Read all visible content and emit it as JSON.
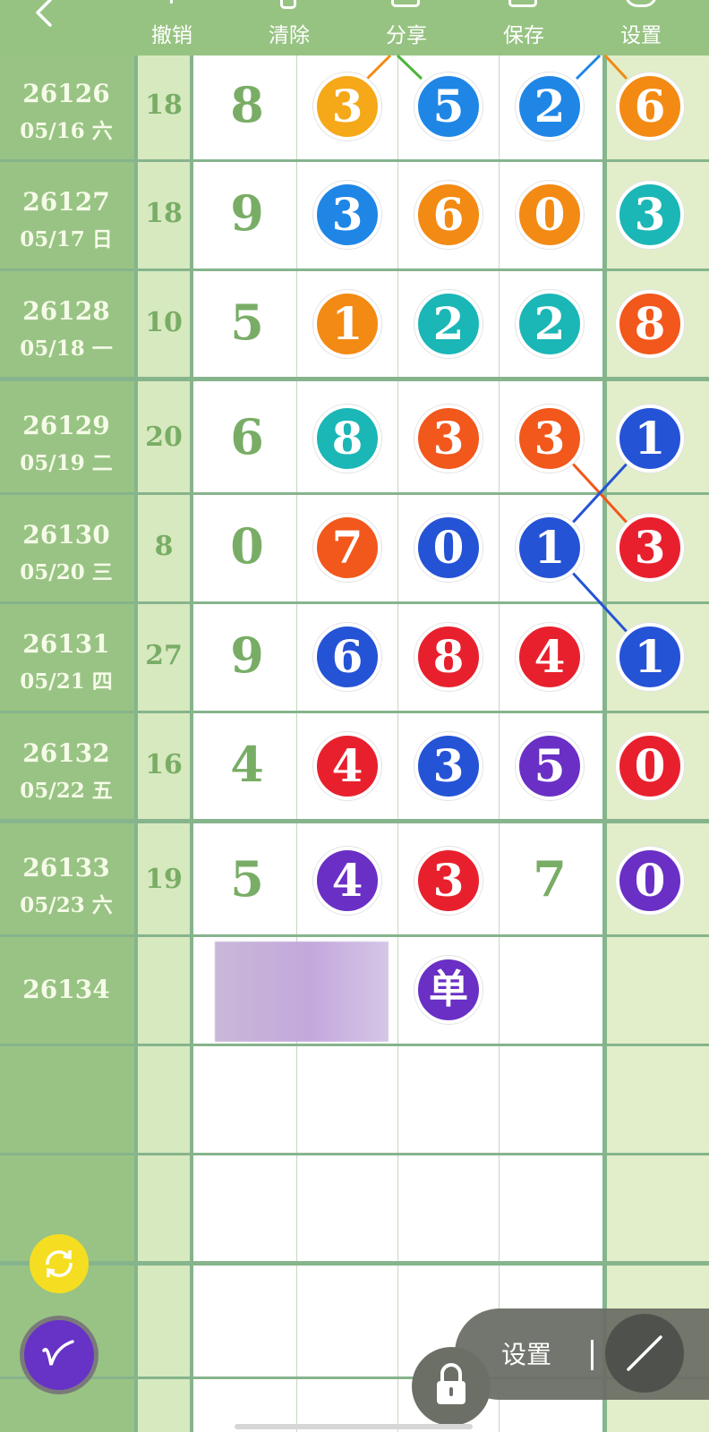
{
  "toolbar": {
    "back_icon": "chevron-left-icon",
    "buttons": [
      {
        "label": "撤销",
        "icon": "undo-icon"
      },
      {
        "label": "清除",
        "icon": "trash-icon"
      },
      {
        "label": "分享",
        "icon": "share-icon"
      },
      {
        "label": "保存",
        "icon": "save-icon"
      },
      {
        "label": "设置",
        "icon": "settings-icon"
      }
    ]
  },
  "rows": [
    {
      "issue": "26126",
      "date": "05/16 六",
      "sum": "18",
      "tail": "8",
      "balls": [
        {
          "n": "3",
          "color": "#f5a818"
        },
        {
          "n": "5",
          "color": "#1f86e6"
        },
        {
          "n": "2",
          "color": "#1f86e6"
        },
        {
          "n": "6",
          "color": "#f38a14"
        }
      ]
    },
    {
      "issue": "26127",
      "date": "05/17 日",
      "sum": "18",
      "tail": "9",
      "balls": [
        {
          "n": "3",
          "color": "#1f86e6"
        },
        {
          "n": "6",
          "color": "#f38a14"
        },
        {
          "n": "0",
          "color": "#f38a14"
        },
        {
          "n": "3",
          "color": "#1bb6b6"
        }
      ]
    },
    {
      "issue": "26128",
      "date": "05/18 一",
      "sum": "10",
      "tail": "5",
      "balls": [
        {
          "n": "1",
          "color": "#f38a14"
        },
        {
          "n": "2",
          "color": "#1bb6b6"
        },
        {
          "n": "2",
          "color": "#1bb6b6"
        },
        {
          "n": "8",
          "color": "#f2571c"
        }
      ]
    },
    {
      "issue": "26129",
      "date": "05/19 二",
      "sum": "20",
      "tail": "6",
      "balls": [
        {
          "n": "8",
          "color": "#1bb6b6"
        },
        {
          "n": "3",
          "color": "#f2571c"
        },
        {
          "n": "3",
          "color": "#f2571c"
        },
        {
          "n": "1",
          "color": "#2553d6"
        }
      ]
    },
    {
      "issue": "26130",
      "date": "05/20 三",
      "sum": "8",
      "tail": "0",
      "balls": [
        {
          "n": "7",
          "color": "#f2571c"
        },
        {
          "n": "0",
          "color": "#2553d6"
        },
        {
          "n": "1",
          "color": "#2553d6"
        },
        {
          "n": "3",
          "color": "#e8202d"
        }
      ]
    },
    {
      "issue": "26131",
      "date": "05/21 四",
      "sum": "27",
      "tail": "9",
      "balls": [
        {
          "n": "6",
          "color": "#2553d6"
        },
        {
          "n": "8",
          "color": "#e8202d"
        },
        {
          "n": "4",
          "color": "#e8202d"
        },
        {
          "n": "1",
          "color": "#2553d6"
        }
      ]
    },
    {
      "issue": "26132",
      "date": "05/22 五",
      "sum": "16",
      "tail": "4",
      "balls": [
        {
          "n": "4",
          "color": "#e8202d"
        },
        {
          "n": "3",
          "color": "#2553d6"
        },
        {
          "n": "5",
          "color": "#6a2fc4"
        },
        {
          "n": "0",
          "color": "#e8202d"
        }
      ]
    },
    {
      "issue": "26133",
      "date": "05/23 六",
      "sum": "19",
      "tail": "5",
      "balls": [
        {
          "n": "4",
          "color": "#6a2fc4"
        },
        {
          "n": "3",
          "color": "#e8202d"
        },
        {
          "n": "7",
          "color": ""
        },
        {
          "n": "0",
          "color": "#6a2fc4"
        }
      ]
    },
    {
      "issue": "26134",
      "date": "",
      "sum": "",
      "tail": "",
      "balls": [
        {
          "n": "",
          "color": ""
        },
        {
          "n": "单",
          "color": "#6a2fc4"
        },
        {
          "n": "",
          "color": ""
        },
        {
          "n": "",
          "color": ""
        }
      ]
    }
  ],
  "floating": {
    "refresh_icon": "refresh-icon",
    "pen_icon": "pen-icon",
    "settings_label": "设置",
    "pencil_icon": "pencil-icon",
    "lock_icon": "lock-icon"
  },
  "colors": {
    "toolbar": "#97c382",
    "left_panel": "#98c384",
    "sum_column": "#d7e9bf",
    "right_column": "#e1eec9"
  }
}
